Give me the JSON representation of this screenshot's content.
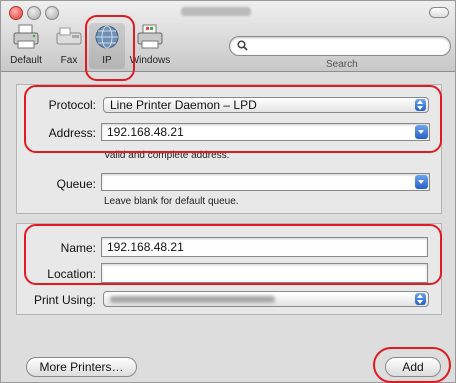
{
  "toolbar": {
    "items": [
      {
        "label": "Default",
        "icon": "printer-icon"
      },
      {
        "label": "Fax",
        "icon": "fax-icon"
      },
      {
        "label": "IP",
        "icon": "globe-icon"
      },
      {
        "label": "Windows",
        "icon": "windows-printer-icon"
      }
    ],
    "search_label": "Search"
  },
  "form": {
    "protocol_label": "Protocol:",
    "protocol_value": "Line Printer Daemon – LPD",
    "address_label": "Address:",
    "address_value": "192.168.48.21",
    "address_hint": "Valid and complete address.",
    "queue_label": "Queue:",
    "queue_value": "",
    "queue_hint": "Leave blank for default queue.",
    "name_label": "Name:",
    "name_value": "192.168.48.21",
    "location_label": "Location:",
    "location_value": "",
    "print_using_label": "Print Using:"
  },
  "buttons": {
    "more_printers": "More Printers…",
    "add": "Add"
  },
  "colors": {
    "highlight": "#e11b22",
    "accent": "#2560c8"
  }
}
